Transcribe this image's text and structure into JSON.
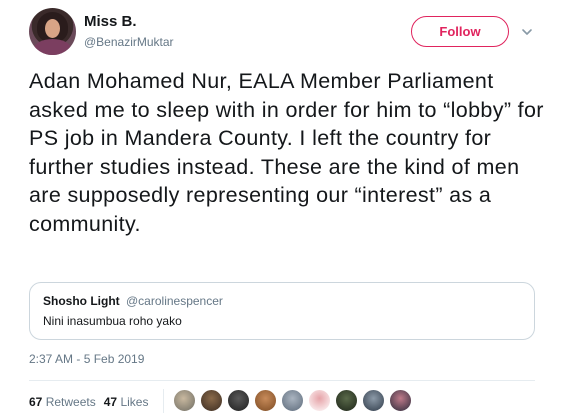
{
  "author": {
    "name": "Miss B.",
    "handle": "@BenazirMuktar",
    "follow_label": "Follow"
  },
  "tweet": {
    "text": "Adan Mohamed Nur, EALA Member Parliament asked me to sleep with in order for him to “lobby” for PS job in Mandera County. I left the country for further studies instead. These are the kind of men are supposedly representing our “interest” as a community.",
    "timestamp": "2:37 AM - 5 Feb 2019"
  },
  "quote": {
    "name": "Shosho Light",
    "handle": "@carolinespencer",
    "text": "Nini inasumbua roho yako"
  },
  "stats": {
    "retweets_count": "67",
    "retweets_label": "Retweets",
    "likes_count": "47",
    "likes_label": "Likes"
  },
  "icons": {
    "menu": "chevron-down-icon"
  },
  "colors": {
    "follow_accent": "#e0245e",
    "secondary_text": "#657786",
    "border": "#ccd6dd"
  }
}
